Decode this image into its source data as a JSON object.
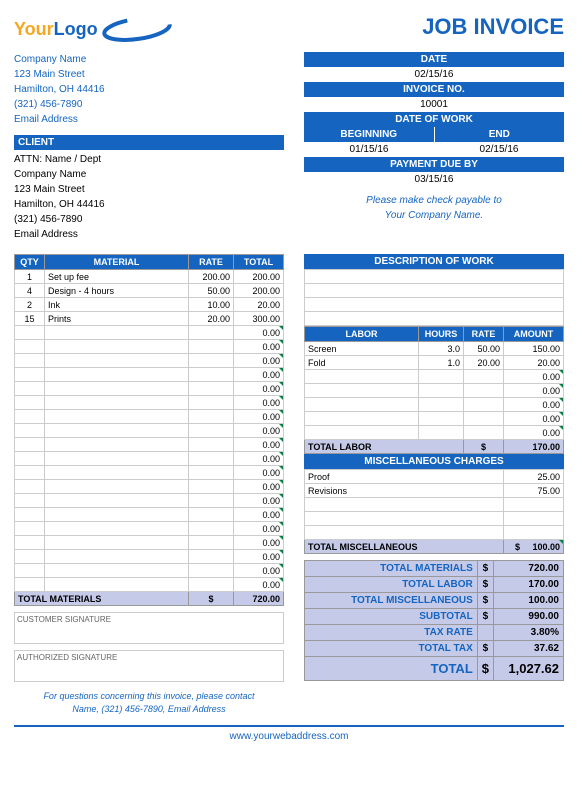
{
  "title": "JOB INVOICE",
  "logo": {
    "your": "Your",
    "logo": "Logo"
  },
  "company": {
    "name": "Company Name",
    "street": "123 Main Street",
    "city": "Hamilton, OH  44416",
    "phone": "(321) 456-7890",
    "email": "Email Address"
  },
  "meta": {
    "date_hdr": "DATE",
    "date": "02/15/16",
    "invno_hdr": "INVOICE NO.",
    "invno": "10001",
    "dow_hdr": "DATE OF WORK",
    "beg_hdr": "BEGINNING",
    "end_hdr": "END",
    "beg": "01/15/16",
    "end": "02/15/16",
    "due_hdr": "PAYMENT DUE BY",
    "due": "03/15/16",
    "payable1": "Please make check payable to",
    "payable2": "Your Company Name."
  },
  "client": {
    "hdr": "CLIENT",
    "attn": "ATTN: Name / Dept",
    "name": "Company Name",
    "street": "123 Main Street",
    "city": "Hamilton, OH  44416",
    "phone": "(321) 456-7890",
    "email": "Email Address"
  },
  "mat": {
    "h": {
      "qty": "QTY",
      "mat": "MATERIAL",
      "rate": "RATE",
      "tot": "TOTAL"
    },
    "rows": [
      {
        "q": "1",
        "m": "Set up fee",
        "r": "200.00",
        "t": "200.00"
      },
      {
        "q": "4",
        "m": "Design - 4 hours",
        "r": "50.00",
        "t": "200.00"
      },
      {
        "q": "2",
        "m": "Ink",
        "r": "10.00",
        "t": "20.00"
      },
      {
        "q": "15",
        "m": "Prints",
        "r": "20.00",
        "t": "300.00"
      }
    ],
    "total_lbl": "TOTAL MATERIALS",
    "total": "720.00"
  },
  "desc_hdr": "DESCRIPTION OF WORK",
  "labor": {
    "h": {
      "l": "LABOR",
      "hr": "HOURS",
      "r": "RATE",
      "a": "AMOUNT"
    },
    "rows": [
      {
        "l": "Screen",
        "h": "3.0",
        "r": "50.00",
        "a": "150.00"
      },
      {
        "l": "Fold",
        "h": "1.0",
        "r": "20.00",
        "a": "20.00"
      }
    ],
    "total_lbl": "TOTAL LABOR",
    "total": "170.00"
  },
  "misc": {
    "hdr": "MISCELLANEOUS CHARGES",
    "rows": [
      {
        "d": "Proof",
        "a": "25.00"
      },
      {
        "d": "Revisions",
        "a": "75.00"
      }
    ],
    "total_lbl": "TOTAL MISCELLANEOUS",
    "total": "100.00"
  },
  "sig": {
    "cust": "CUSTOMER SIGNATURE",
    "auth": "AUTHORIZED SIGNATURE"
  },
  "contact": {
    "l1": "For questions concerning this invoice, please contact",
    "l2": "Name, (321) 456-7890, Email Address"
  },
  "sum": {
    "mat_l": "TOTAL MATERIALS",
    "mat": "720.00",
    "lab_l": "TOTAL LABOR",
    "lab": "170.00",
    "misc_l": "TOTAL MISCELLANEOUS",
    "misc": "100.00",
    "sub_l": "SUBTOTAL",
    "sub": "990.00",
    "rate_l": "TAX RATE",
    "rate": "3.80%",
    "tax_l": "TOTAL TAX",
    "tax": "37.62",
    "tot_l": "TOTAL",
    "tot": "1,027.62"
  },
  "foot": "www.yourwebaddress.com",
  "z": "0.00",
  "dol": "$"
}
